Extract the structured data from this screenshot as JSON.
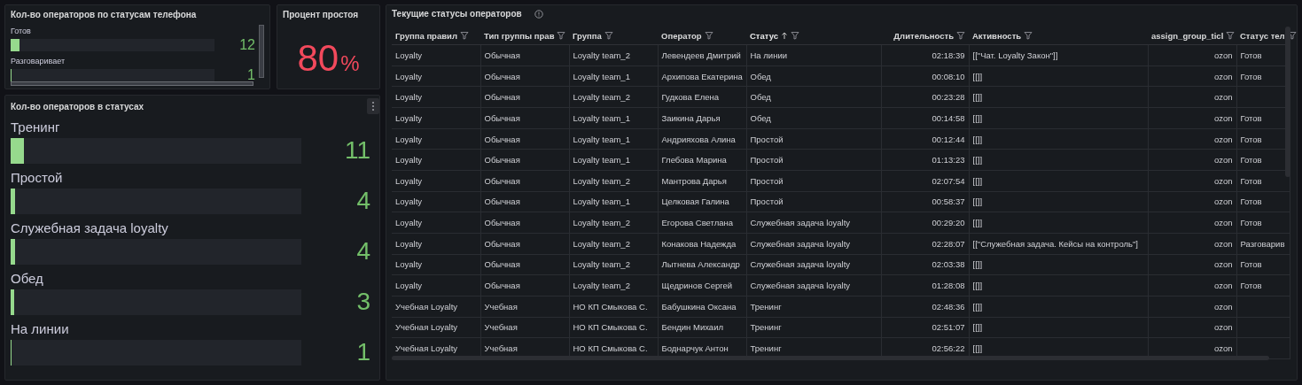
{
  "phone_panel": {
    "title": "Кол-во операторов по статусам телефона",
    "items": [
      {
        "label": "Готов",
        "level": 0.045,
        "value": "12"
      },
      {
        "label": "Разговаривает",
        "level": 0.006,
        "value": "1"
      }
    ]
  },
  "idle_panel": {
    "title": "Процент простоя",
    "value": "80",
    "unit": "%"
  },
  "status_panel": {
    "title": "Кол-во операторов в статусах",
    "items": [
      {
        "label": "Тренинг",
        "level": 0.045,
        "value": "11"
      },
      {
        "label": "Простой",
        "level": 0.016,
        "value": "4"
      },
      {
        "label": "Служебная задача loyalty",
        "level": 0.016,
        "value": "4"
      },
      {
        "label": "Обед",
        "level": 0.013,
        "value": "3"
      },
      {
        "label": "На линии",
        "level": 0.004,
        "value": "1"
      }
    ]
  },
  "table": {
    "title": "Текущие статусы операторов",
    "columns": [
      {
        "label": "Группа правил",
        "kind": "text",
        "sorted": false
      },
      {
        "label": "Тип группы прав",
        "kind": "text",
        "sorted": false
      },
      {
        "label": "Группа",
        "kind": "text",
        "sorted": false
      },
      {
        "label": "Оператор",
        "kind": "text",
        "sorted": false
      },
      {
        "label": "Статус",
        "kind": "text",
        "sorted": true
      },
      {
        "label": "Длительность",
        "kind": "numeric",
        "sorted": false
      },
      {
        "label": "Активность",
        "kind": "text",
        "sorted": false
      },
      {
        "label": "assign_group_ticl",
        "kind": "numeric",
        "sorted": false
      },
      {
        "label": "Статус тел",
        "kind": "text",
        "sorted": false
      }
    ],
    "rows": [
      [
        "Loyalty",
        "Обычная",
        "Loyalty team_2",
        "Левендеев Дмитрий",
        "На линии",
        "02:18:39",
        "[[\"Чат. Loyalty Закон\"]]",
        "ozon",
        "Готов"
      ],
      [
        "Loyalty",
        "Обычная",
        "Loyalty team_1",
        "Архипова Екатерина",
        "Обед",
        "00:08:10",
        "[[]]",
        "ozon",
        "Готов"
      ],
      [
        "Loyalty",
        "Обычная",
        "Loyalty team_2",
        "Гудкова Елена",
        "Обед",
        "00:23:28",
        "[[]]",
        "ozon",
        ""
      ],
      [
        "Loyalty",
        "Обычная",
        "Loyalty team_1",
        "Заикина Дарья",
        "Обед",
        "00:14:58",
        "[[]]",
        "ozon",
        "Готов"
      ],
      [
        "Loyalty",
        "Обычная",
        "Loyalty team_1",
        "Андрияхова Алина",
        "Простой",
        "00:12:44",
        "[[]]",
        "ozon",
        "Готов"
      ],
      [
        "Loyalty",
        "Обычная",
        "Loyalty team_1",
        "Глебова Марина",
        "Простой",
        "01:13:23",
        "[[]]",
        "ozon",
        "Готов"
      ],
      [
        "Loyalty",
        "Обычная",
        "Loyalty team_2",
        "Мантрова Дарья",
        "Простой",
        "02:07:54",
        "[[]]",
        "ozon",
        "Готов"
      ],
      [
        "Loyalty",
        "Обычная",
        "Loyalty team_1",
        "Целковая Галина",
        "Простой",
        "00:58:37",
        "[[]]",
        "ozon",
        "Готов"
      ],
      [
        "Loyalty",
        "Обычная",
        "Loyalty team_2",
        "Егорова Светлана",
        "Служебная задача loyalty",
        "00:29:20",
        "[[]]",
        "ozon",
        "Готов"
      ],
      [
        "Loyalty",
        "Обычная",
        "Loyalty team_2",
        "Конакова Надежда",
        "Служебная задача loyalty",
        "02:28:07",
        "[[\"Служебная задача. Кейсы на контроль\"]",
        "ozon",
        "Разговарив"
      ],
      [
        "Loyalty",
        "Обычная",
        "Loyalty team_2",
        "Лытнева Александр",
        "Служебная задача loyalty",
        "02:03:38",
        "[[]]",
        "ozon",
        "Готов"
      ],
      [
        "Loyalty",
        "Обычная",
        "Loyalty team_2",
        "Щедринов Сергей",
        "Служебная задача loyalty",
        "01:28:08",
        "[[]]",
        "ozon",
        "Готов"
      ],
      [
        "Учебная Loyalty",
        "Учебная",
        "НО КП Смыкова С.",
        "Бабушкина Оксана",
        "Тренинг",
        "02:48:36",
        "[[]]",
        "ozon",
        ""
      ],
      [
        "Учебная Loyalty",
        "Учебная",
        "НО КП Смыкова С.",
        "Бендин Михаил",
        "Тренинг",
        "02:51:07",
        "[[]]",
        "ozon",
        ""
      ],
      [
        "Учебная Loyalty",
        "Учебная",
        "НО КП Смыкова С.",
        "Боднарчук Антон",
        "Тренинг",
        "02:56:22",
        "[[]]",
        "ozon",
        ""
      ]
    ]
  }
}
